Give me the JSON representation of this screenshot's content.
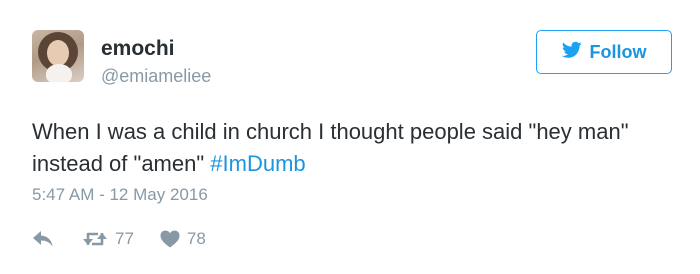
{
  "user": {
    "display_name": "emochi",
    "handle": "@emiameliee"
  },
  "follow_button": {
    "label": "Follow",
    "icon": "twitter-bird-icon"
  },
  "tweet": {
    "text_before": "When I was a child in church I thought people said \"hey man\" instead of \"amen\" ",
    "hashtag": "#ImDumb",
    "timestamp": "5:47 AM - 12 May 2016"
  },
  "actions": {
    "reply_icon": "reply-icon",
    "retweet_icon": "retweet-icon",
    "retweet_count": "77",
    "like_icon": "heart-icon",
    "like_count": "78"
  },
  "colors": {
    "accent": "#1b95e0",
    "muted": "#8899a6",
    "text": "#292f33"
  }
}
